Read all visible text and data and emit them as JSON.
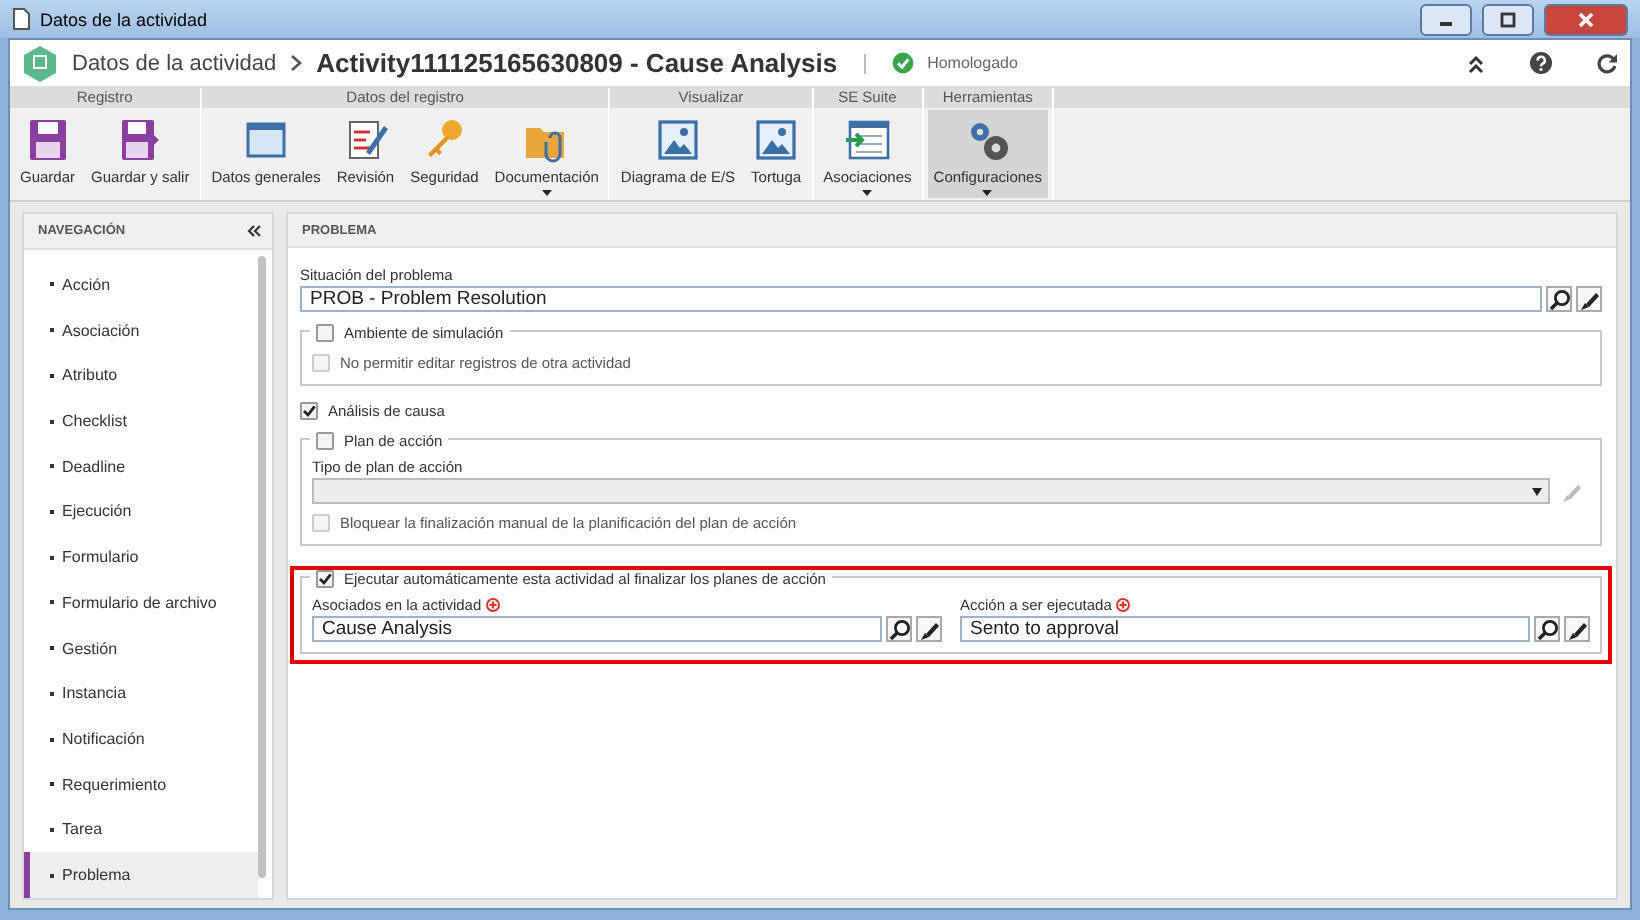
{
  "window": {
    "title": "Datos de la actividad"
  },
  "header": {
    "breadcrumb": "Datos de la actividad",
    "title": "Activity111125165630809 - Cause Analysis",
    "status": "Homologado"
  },
  "ribbon": {
    "groups": [
      {
        "label": "Registro",
        "buttons": [
          {
            "label": "Guardar",
            "kind": "save",
            "dropdown": false,
            "selected": false
          },
          {
            "label": "Guardar y salir",
            "kind": "saveexit",
            "dropdown": false,
            "selected": false
          }
        ]
      },
      {
        "label": "Datos del registro",
        "buttons": [
          {
            "label": "Datos generales",
            "kind": "window",
            "dropdown": false,
            "selected": false
          },
          {
            "label": "Revisión",
            "kind": "review",
            "dropdown": false,
            "selected": false
          },
          {
            "label": "Seguridad",
            "kind": "key",
            "dropdown": false,
            "selected": false
          },
          {
            "label": "Documentación",
            "kind": "folder",
            "dropdown": true,
            "selected": false
          }
        ]
      },
      {
        "label": "Visualizar",
        "buttons": [
          {
            "label": "Diagrama de E/S",
            "kind": "picture",
            "dropdown": false,
            "selected": false
          },
          {
            "label": "Tortuga",
            "kind": "picture",
            "dropdown": false,
            "selected": false
          }
        ]
      },
      {
        "label": "SE Suite",
        "buttons": [
          {
            "label": "Asociaciones",
            "kind": "assoc",
            "dropdown": true,
            "selected": false
          }
        ]
      },
      {
        "label": "Herramientas",
        "buttons": [
          {
            "label": "Configuraciones",
            "kind": "gears",
            "dropdown": true,
            "selected": true
          }
        ]
      }
    ]
  },
  "navigation": {
    "title": "NAVEGACIÓN",
    "items": [
      {
        "label": "Acción",
        "selected": false
      },
      {
        "label": "Asociación",
        "selected": false
      },
      {
        "label": "Atributo",
        "selected": false
      },
      {
        "label": "Checklist",
        "selected": false
      },
      {
        "label": "Deadline",
        "selected": false
      },
      {
        "label": "Ejecución",
        "selected": false
      },
      {
        "label": "Formulario",
        "selected": false
      },
      {
        "label": "Formulario de archivo",
        "selected": false
      },
      {
        "label": "Gestión",
        "selected": false
      },
      {
        "label": "Instancia",
        "selected": false
      },
      {
        "label": "Notificación",
        "selected": false
      },
      {
        "label": "Requerimiento",
        "selected": false
      },
      {
        "label": "Tarea",
        "selected": false
      },
      {
        "label": "Problema",
        "selected": true
      }
    ]
  },
  "panel": {
    "title": "PROBLEMA",
    "problem_status": {
      "label": "Situación del problema",
      "value": "PROB - Problem Resolution"
    },
    "simulation": {
      "label": "Ambiente de simulación",
      "checked": false,
      "option": {
        "label": "No permitir editar registros de otra actividad",
        "checked": false,
        "disabled": true
      }
    },
    "cause_analysis": {
      "label": "Análisis de causa",
      "checked": true
    },
    "action_plan": {
      "label": "Plan de acción",
      "checked": false,
      "type_label": "Tipo de plan de acción",
      "select_disabled": true,
      "option": {
        "label": "Bloquear la finalización manual de la planificación del plan de acción",
        "checked": false,
        "disabled": true
      }
    },
    "auto_execute": {
      "label": "Ejecutar automáticamente esta actividad al finalizar los planes de acción",
      "checked": true,
      "highlighted": true,
      "fields": [
        {
          "label": "Asociados en la actividad",
          "value": "Cause Analysis",
          "required": true
        },
        {
          "label": "Acción a ser ejecutada",
          "value": "Sento to approval",
          "required": true
        }
      ]
    }
  }
}
